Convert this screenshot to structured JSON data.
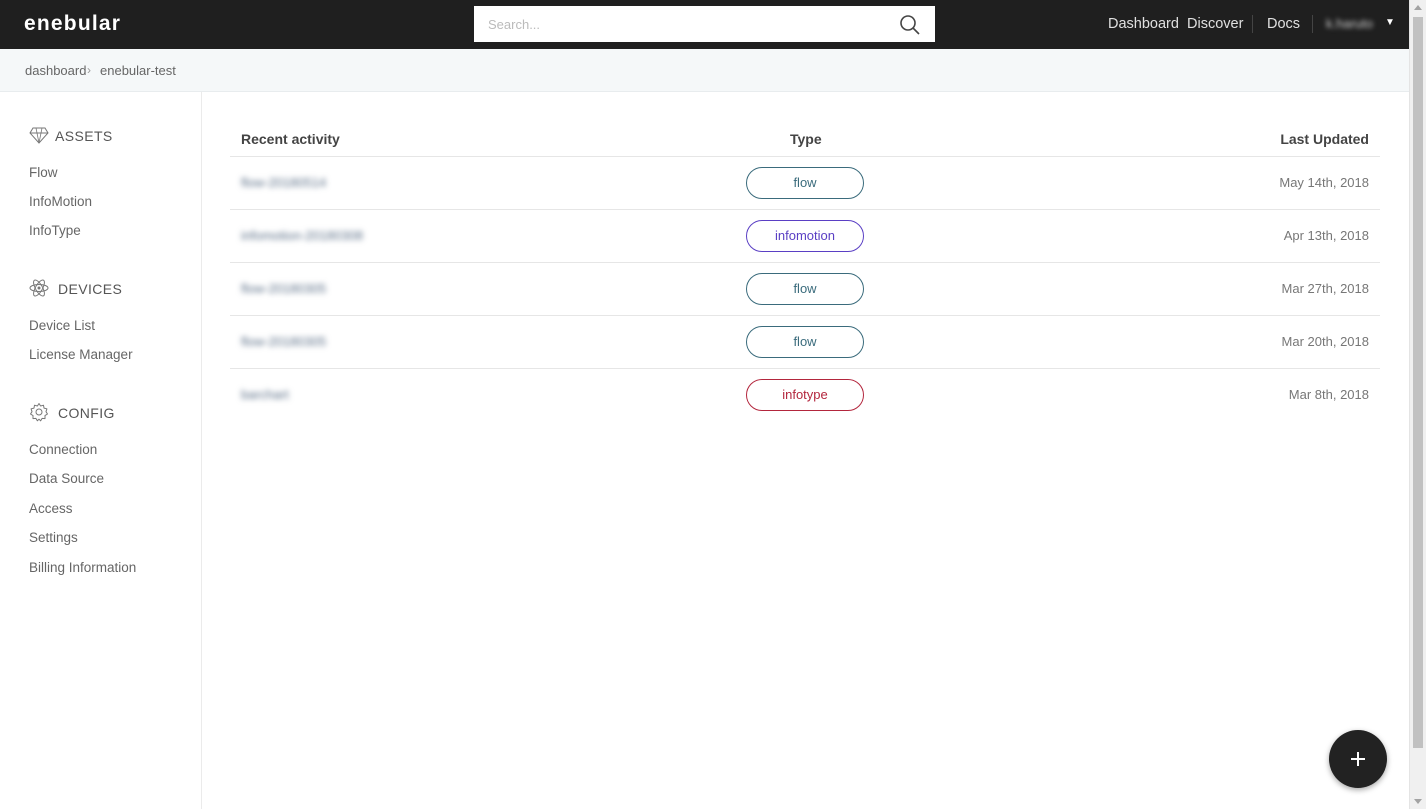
{
  "app": {
    "logo": "enebular"
  },
  "search": {
    "placeholder": "Search..."
  },
  "nav": {
    "dashboard": "Dashboard",
    "discover": "Discover",
    "docs": "Docs",
    "user": "k.haruto"
  },
  "breadcrumb": {
    "items": [
      "dashboard",
      "enebular-test"
    ],
    "separator": "›"
  },
  "sidebar": {
    "assets": {
      "title": "ASSETS",
      "items": [
        "Flow",
        "InfoMotion",
        "InfoType"
      ]
    },
    "devices": {
      "title": "DEVICES",
      "items": [
        "Device List",
        "License Manager"
      ]
    },
    "config": {
      "title": "CONFIG",
      "items": [
        "Connection",
        "Data Source",
        "Access",
        "Settings",
        "Billing Information"
      ]
    }
  },
  "table": {
    "headers": {
      "activity": "Recent activity",
      "type": "Type",
      "updated": "Last Updated"
    },
    "rows": [
      {
        "name": "flow-20180514",
        "type": "flow",
        "updated": "May 14th, 2018"
      },
      {
        "name": "infomotion-20180308",
        "type": "infomotion",
        "updated": "Apr 13th, 2018"
      },
      {
        "name": "flow-20180305",
        "type": "flow",
        "updated": "Mar 27th, 2018"
      },
      {
        "name": "flow-20180305",
        "type": "flow",
        "updated": "Mar 20th, 2018"
      },
      {
        "name": "barchart",
        "type": "infotype",
        "updated": "Mar 8th, 2018"
      }
    ]
  },
  "colors": {
    "flow": "#3a6b7c",
    "infomotion": "#5a3fc4",
    "infotype": "#b3263d",
    "topbar": "#1f1f1f"
  },
  "fab": {
    "icon": "plus-icon"
  }
}
